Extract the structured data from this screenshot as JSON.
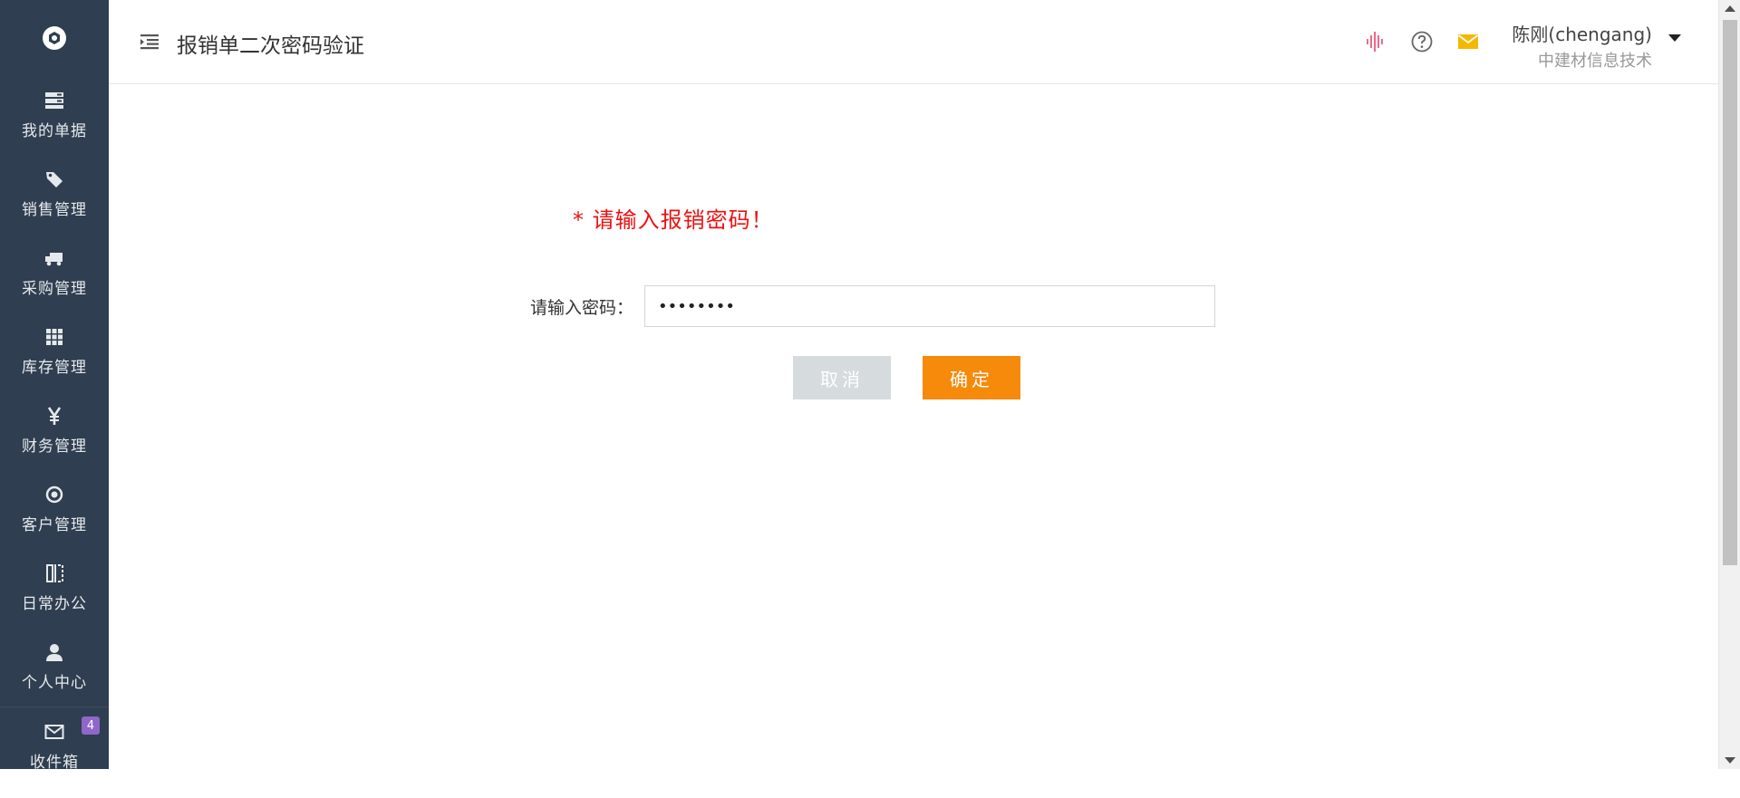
{
  "header": {
    "title": "报销单二次密码验证",
    "user": {
      "name": "陈刚(chengang)",
      "org": "中建材信息技术"
    }
  },
  "sidebar": {
    "items": [
      {
        "label": "我的单据",
        "icon": "stacked-list-icon"
      },
      {
        "label": "销售管理",
        "icon": "tag-icon"
      },
      {
        "label": "采购管理",
        "icon": "truck-icon"
      },
      {
        "label": "库存管理",
        "icon": "grid-icon"
      },
      {
        "label": "财务管理",
        "icon": "yen-icon"
      },
      {
        "label": "客户管理",
        "icon": "target-icon"
      },
      {
        "label": "日常办公",
        "icon": "columns-icon"
      },
      {
        "label": "个人中心",
        "icon": "user-icon"
      },
      {
        "label": "收件箱",
        "icon": "mail-icon",
        "badge": "4"
      }
    ]
  },
  "form": {
    "prompt": "* 请输入报销密码！",
    "password_label": "请输入密码：",
    "password_value": "••••••••",
    "cancel_label": "取消",
    "confirm_label": "确定"
  },
  "colors": {
    "sidebar_bg": "#2f3e50",
    "prompt": "#ee1010",
    "confirm": "#f68a0a",
    "cancel": "#d6dbde",
    "mail_icon": "#f5b800",
    "voice_icon": "#f06b8b"
  }
}
